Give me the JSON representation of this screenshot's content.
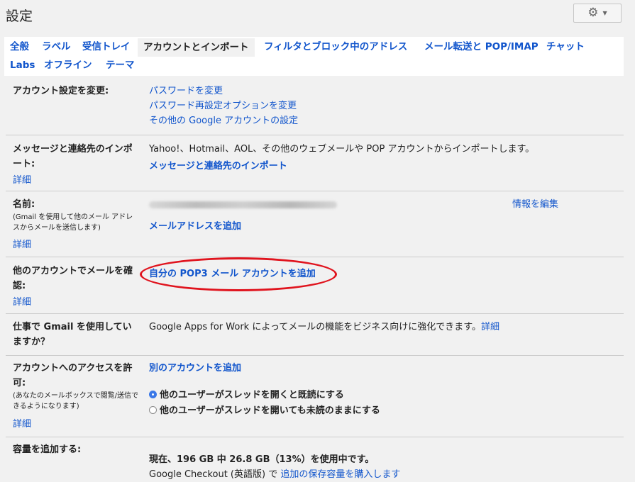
{
  "header": {
    "title": "設定"
  },
  "tabs": [
    "全般",
    "ラベル",
    "受信トレイ",
    "アカウントとインポート",
    "フィルタとブロック中のアドレス",
    "メール転送と POP/IMAP",
    "チャット",
    "Labs",
    "オフライン",
    "テーマ"
  ],
  "rows": {
    "account": {
      "label": "アカウント設定を変更:",
      "links": [
        "パスワードを変更",
        "パスワード再設定オプションを変更",
        "その他の Google アカウントの設定"
      ]
    },
    "import": {
      "label": "メッセージと連絡先のインポート:",
      "detail": "詳細",
      "text": "Yahoo!、Hotmail、AOL、その他のウェブメールや POP アカウントからインポートします。",
      "link": "メッセージと連絡先のインポート"
    },
    "name": {
      "label": "名前:",
      "sub": "(Gmail を使用して他のメール アドレスからメールを送信します)",
      "detail": "詳細",
      "edit": "情報を編集",
      "add": "メールアドレスを追加"
    },
    "pop3": {
      "label": "他のアカウントでメールを確認:",
      "detail": "詳細",
      "link": "自分の POP3 メール アカウントを追加"
    },
    "work": {
      "label": "仕事で Gmail を使用していますか？",
      "text": "Google Apps for Work によってメールの機能をビジネス向けに強化できます。",
      "link": "詳細"
    },
    "access": {
      "label": "アカウントへのアクセスを許可:",
      "sub": "(あなたのメールボックスで閲覧/送信できるようになります)",
      "detail": "詳細",
      "add": "別のアカウントを追加",
      "options": [
        "他のユーザーがスレッドを開くと既読にする",
        "他のユーザーがスレッドを開いても未読のままにする"
      ],
      "selected": 0
    },
    "storage": {
      "label": "容量を追加する:",
      "usage": "現在、196 GB 中 26.8 GB（13%）を使用中です。",
      "checkout": "Google Checkout (英語版) で",
      "buy": "追加の保存容量を購入します"
    }
  },
  "icons": {
    "settings": "gear-icon",
    "dropdown": "caret-down-icon"
  },
  "colors": {
    "link": "#1155cc",
    "highlight": "#e0141e",
    "radio": "#3b78e7"
  }
}
